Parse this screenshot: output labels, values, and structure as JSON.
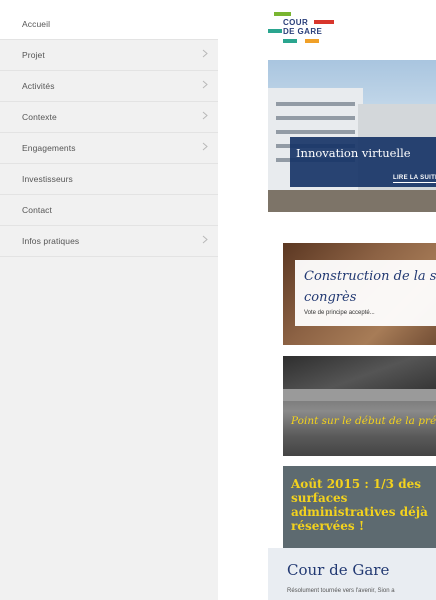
{
  "sidebar": {
    "items": [
      {
        "label": "Accueil",
        "has_submenu": false,
        "active": true
      },
      {
        "label": "Projet",
        "has_submenu": true,
        "active": false
      },
      {
        "label": "Activités",
        "has_submenu": true,
        "active": false
      },
      {
        "label": "Contexte",
        "has_submenu": true,
        "active": false
      },
      {
        "label": "Engagements",
        "has_submenu": true,
        "active": false
      },
      {
        "label": "Investisseurs",
        "has_submenu": false,
        "active": false
      },
      {
        "label": "Contact",
        "has_submenu": false,
        "active": false
      },
      {
        "label": "Infos pratiques",
        "has_submenu": true,
        "active": false
      }
    ],
    "chevron_icon": "chevron-right-icon"
  },
  "logo": {
    "line1": "COUR",
    "line2": "DE GARE",
    "colors": {
      "green": "#79b531",
      "red": "#d8362c",
      "teal": "#2aa58f",
      "orange": "#f0a028",
      "navy": "#2a3f7a"
    }
  },
  "hero": {
    "title": "Innovation virtuelle",
    "link": "LIRE LA SUITE"
  },
  "cards": [
    {
      "title": "Construction de la salle de congrès",
      "subtitle": "Vote de principe accepté..."
    },
    {
      "title": "Point sur le début de la pré-"
    },
    {
      "title": "Août 2015 : 1/3 des surfaces administratives déjà réservées !"
    }
  ],
  "footer": {
    "title": "Cour de Gare",
    "text": "Résolument tournée vers l'avenir, Sion a"
  },
  "colors": {
    "navy": "#233a73",
    "yellow": "#f3d21d",
    "sidebar_bg": "#f1f1f1"
  }
}
